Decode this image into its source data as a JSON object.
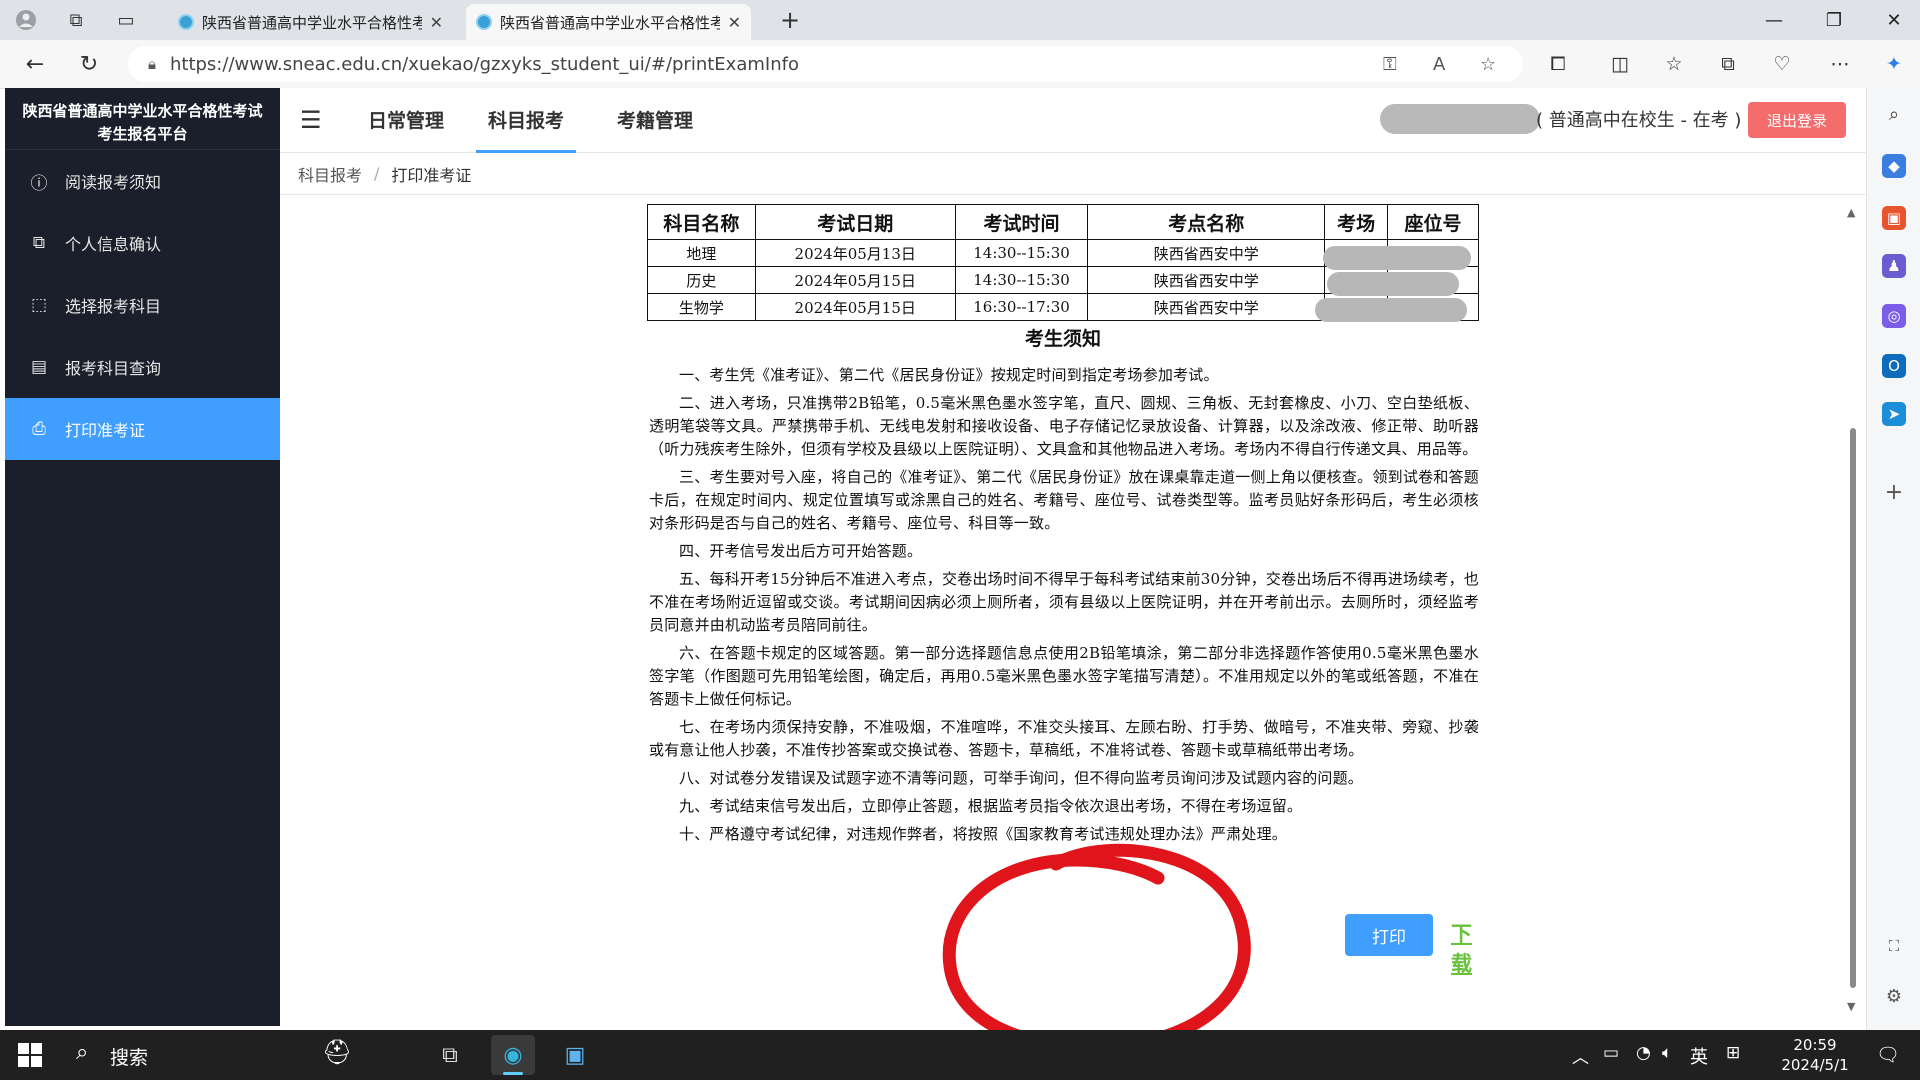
{
  "browser": {
    "tabs": [
      {
        "title": "陕西省普通高中学业水平合格性考",
        "active": false
      },
      {
        "title": "陕西省普通高中学业水平合格性考",
        "active": true
      }
    ],
    "url": "https://www.sneac.edu.cn/xuekao/gzxyks_student_ui/#/printExamInfo"
  },
  "sidebar": {
    "title_line1": "陕西省普通高中学业水平合格性考试",
    "title_line2": "考生报名平台",
    "items": [
      {
        "label": "阅读报考须知",
        "icon": "info-icon",
        "active": false
      },
      {
        "label": "个人信息确认",
        "icon": "copy-icon",
        "active": false
      },
      {
        "label": "选择报考科目",
        "icon": "select-icon",
        "active": false
      },
      {
        "label": "报考科目查询",
        "icon": "list-icon",
        "active": false
      },
      {
        "label": "打印准考证",
        "icon": "printer-icon",
        "active": true
      }
    ]
  },
  "header": {
    "tabs": [
      {
        "label": "日常管理",
        "active": false
      },
      {
        "label": "科目报考",
        "active": true
      },
      {
        "label": "考籍管理",
        "active": false
      }
    ],
    "user_role": "( 普通高中在校生 - 在考 )",
    "logout_label": "退出登录"
  },
  "breadcrumb": {
    "parent": "科目报考",
    "separator": "/",
    "current": "打印准考证"
  },
  "exam_table": {
    "headers": [
      "科目名称",
      "考试日期",
      "考试时间",
      "考点名称",
      "考场",
      "座位号"
    ],
    "rows": [
      [
        "地理",
        "2024年05月13日",
        "14:30--15:30",
        "陕西省西安中学",
        "",
        ""
      ],
      [
        "历史",
        "2024年05月15日",
        "14:30--15:30",
        "陕西省西安中学",
        "",
        ""
      ],
      [
        "生物学",
        "2024年05月15日",
        "16:30--17:30",
        "陕西省西安中学",
        "",
        ""
      ]
    ]
  },
  "notice": {
    "title": "考生须知",
    "items": [
      "一、考生凭《准考证》、第二代《居民身份证》按规定时间到指定考场参加考试。",
      "二、进入考场，只准携带2B铅笔，0.5毫米黑色墨水签字笔，直尺、圆规、三角板、无封套橡皮、小刀、空白垫纸板、透明笔袋等文具。严禁携带手机、无线电发射和接收设备、电子存储记忆录放设备、计算器，以及涂改液、修正带、助听器（听力残疾考生除外，但须有学校及县级以上医院证明）、文具盒和其他物品进入考场。考场内不得自行传递文具、用品等。",
      "三、考生要对号入座，将自己的《准考证》、第二代《居民身份证》放在课桌靠走道一侧上角以便核查。领到试卷和答题卡后，在规定时间内、规定位置填写或涂黑自己的姓名、考籍号、座位号、试卷类型等。监考员贴好条形码后，考生必须核对条形码是否与自己的姓名、考籍号、座位号、科目等一致。",
      "四、开考信号发出后方可开始答题。",
      "五、每科开考15分钟后不准进入考点，交卷出场时间不得早于每科考试结束前30分钟，交卷出场后不得再进场续考，也不准在考场附近逗留或交谈。考试期间因病必须上厕所者，须有县级以上医院证明，并在开考前出示。去厕所时，须经监考员同意并由机动监考员陪同前往。",
      "六、在答题卡规定的区域答题。第一部分选择题信息点使用2B铅笔填涂，第二部分非选择题作答使用0.5毫米黑色墨水签字笔（作图题可先用铅笔绘图，确定后，再用0.5毫米黑色墨水签字笔描写清楚）。不准用规定以外的笔或纸答题，不准在答题卡上做任何标记。",
      "七、在考场内须保持安静，不准吸烟，不准喧哗，不准交头接耳、左顾右盼、打手势、做暗号，不准夹带、旁窥、抄袭或有意让他人抄袭，不准传抄答案或交换试卷、答题卡，草稿纸，不准将试卷、答题卡或草稿纸带出考场。",
      "八、对试卷分发错误及试题字迹不清等问题，可举手询问，但不得向监考员询问涉及试题内容的问题。",
      "九、考试结束信号发出后，立即停止答题，根据监考员指令依次退出考场，不得在考场逗留。",
      "十、严格遵守考试纪律，对违规作弊者，将按照《国家教育考试违规处理办法》严肃处理。"
    ]
  },
  "actions": {
    "print_label": "打印",
    "download_label": "下载"
  },
  "annotation": {
    "color": "#e0151b"
  },
  "taskbar": {
    "search_label": "搜索",
    "ime": "英",
    "time": "20:59",
    "date": "2024/5/1"
  },
  "colors": {
    "accent": "#409eff",
    "sidebar_bg": "#1b1e2b",
    "logout": "#f56c6c",
    "download": "#67c23a"
  }
}
